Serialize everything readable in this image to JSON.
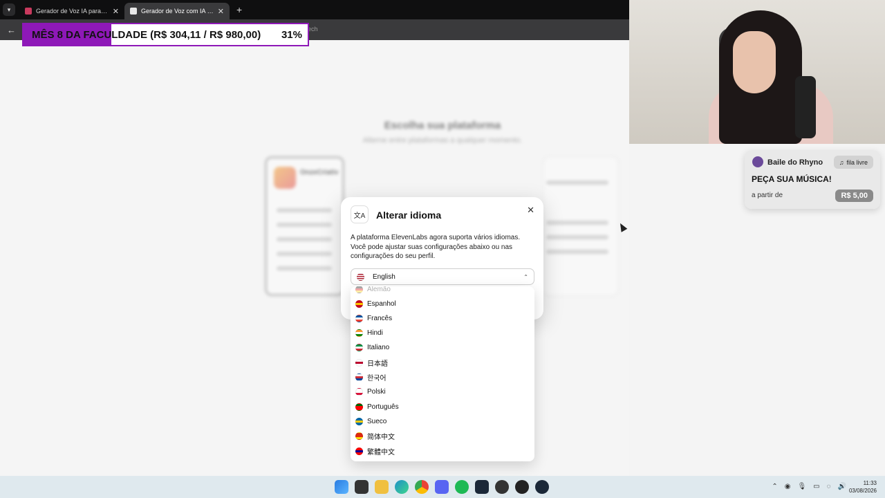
{
  "browser": {
    "tabs": [
      {
        "title": "Gerador de Voz IA para Locução",
        "active": false
      },
      {
        "title": "Gerador de Voz com IA e Conv",
        "active": true
      }
    ],
    "url_partial": "eech"
  },
  "overlay": {
    "text": "MÊS 8 DA FACULDADE (R$ 304,11 / R$ 980,00)",
    "percent": "31%",
    "progress": 0.31,
    "color": "#8e18b8"
  },
  "background_page": {
    "title": "Escolha sua plataforma",
    "subtitle": "Alterne entre plataformas a qualquer momento.",
    "card_title": "OnzeCriativ"
  },
  "modal": {
    "title": "Alterar idioma",
    "icon": "translate-icon",
    "description": "A plataforma ElevenLabs agora suporta vários idiomas. Você pode ajustar suas configurações abaixo ou nas configurações do seu perfil.",
    "selected_language": "English"
  },
  "languages": [
    {
      "label": "Alemão",
      "flag": [
        "#000000",
        "#dd0000",
        "#ffce00"
      ]
    },
    {
      "label": "Espanhol",
      "flag": [
        "#c60b1e",
        "#ffc400",
        "#c60b1e"
      ]
    },
    {
      "label": "Francês",
      "flag": [
        "#0055a4",
        "#ffffff",
        "#ef4135"
      ]
    },
    {
      "label": "Hindi",
      "flag": [
        "#ff9933",
        "#ffffff",
        "#138808"
      ]
    },
    {
      "label": "Italiano",
      "flag": [
        "#009246",
        "#ffffff",
        "#ce2b37"
      ]
    },
    {
      "label": "日本語",
      "flag": [
        "#ffffff",
        "#bc002d",
        "#ffffff"
      ]
    },
    {
      "label": "한국어",
      "flag": [
        "#ffffff",
        "#cd2e3a",
        "#0047a0"
      ]
    },
    {
      "label": "Polski",
      "flag": [
        "#ffffff",
        "#ffffff",
        "#dc143c"
      ]
    },
    {
      "label": "Português",
      "flag": [
        "#006600",
        "#ff0000",
        "#ff0000"
      ]
    },
    {
      "label": "Sueco",
      "flag": [
        "#006aa7",
        "#fecc00",
        "#006aa7"
      ]
    },
    {
      "label": "简体中文",
      "flag": [
        "#de2910",
        "#de2910",
        "#ffde00"
      ]
    },
    {
      "label": "繁體中文",
      "flag": [
        "#fe0000",
        "#000095",
        "#fe0000"
      ]
    }
  ],
  "widget": {
    "name": "Baile do Rhyno",
    "tag": "fila livre",
    "headline": "PEÇA SUA MÚSICA!",
    "from_label": "a partir de",
    "price": "R$ 5,00"
  },
  "taskbar": {
    "time": "11:33",
    "date": "03/08/2026"
  }
}
